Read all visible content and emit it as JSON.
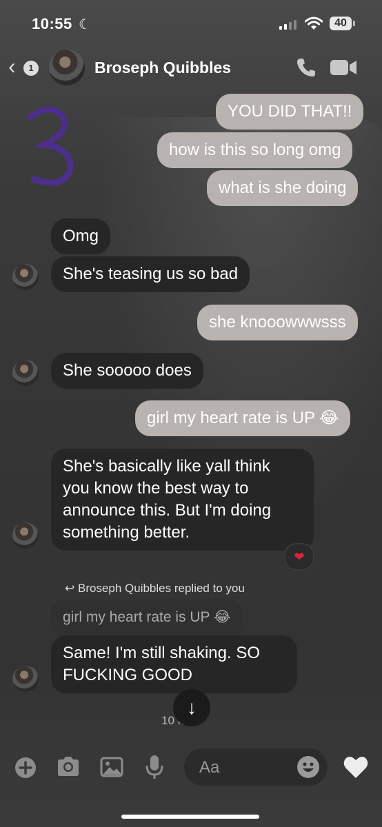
{
  "status_bar": {
    "time": "10:55",
    "battery": "40"
  },
  "header": {
    "unread_count": "1",
    "contact_name": "Broseph Quibbles"
  },
  "messages": [
    {
      "side": "out",
      "text": "YOU DID THAT!!"
    },
    {
      "side": "out",
      "text": "how is this so long omg"
    },
    {
      "side": "out",
      "text": "what is she doing"
    },
    {
      "side": "in",
      "text": "Omg"
    },
    {
      "side": "in",
      "text": "She's teasing us so bad"
    },
    {
      "side": "out",
      "text": "she knooowwwsss"
    },
    {
      "side": "in",
      "text": "She sooooo does"
    },
    {
      "side": "out",
      "text": "girl my heart rate is UP 😂"
    },
    {
      "side": "in",
      "lines": [
        "She's basically like yall think",
        "you know the best way to",
        "announce this. But I'm doing",
        "something better."
      ],
      "reaction": "heart"
    },
    {
      "side": "in",
      "lines": [
        "Same! I'm still shaking. SO",
        "FUCKING GOOD"
      ]
    }
  ],
  "reply": {
    "note": "Broseph Quibbles replied to you",
    "quoted_text": "girl my heart rate is UP 😂"
  },
  "timestamp": "10 M",
  "composer": {
    "placeholder": "Aa"
  },
  "colors": {
    "outgoing_bubble": "#b8b3b0",
    "incoming_bubble": "#262626",
    "reaction_heart": "#e0243b"
  }
}
